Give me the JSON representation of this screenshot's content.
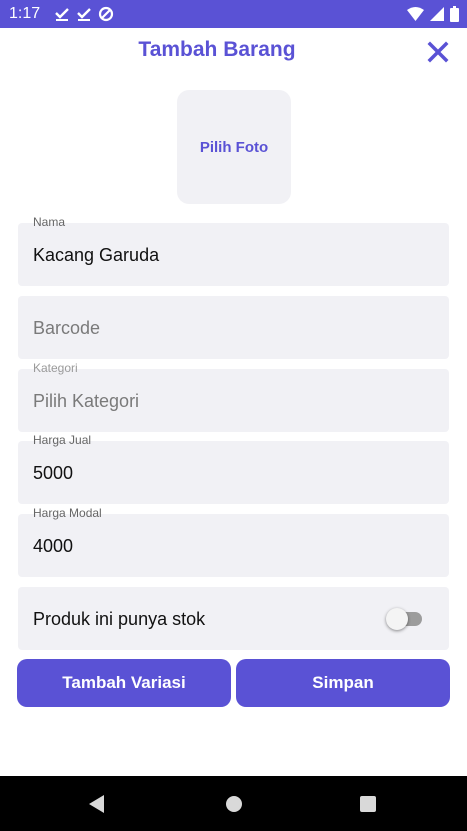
{
  "status_bar": {
    "time": "1:17",
    "left_icons": [
      "check-icon",
      "check-icon",
      "data-saver-icon"
    ],
    "right_icons": [
      "wifi-icon",
      "signal-icon",
      "battery-icon"
    ],
    "color": "#5a52d5"
  },
  "header": {
    "title": "Tambah Barang",
    "close_icon": "close-icon",
    "accent_color": "#5a52d5"
  },
  "photo": {
    "label": "Pilih Foto"
  },
  "fields": [
    {
      "label": "Nama",
      "value": "Kacang Garuda",
      "placeholder": ""
    },
    {
      "label": "",
      "value": "",
      "placeholder": "Barcode"
    },
    {
      "label": "Kategori",
      "value": "",
      "placeholder": "Pilih Kategori"
    },
    {
      "label": "Harga Jual",
      "value": "5000",
      "placeholder": ""
    },
    {
      "label": "Harga Modal",
      "value": "4000",
      "placeholder": ""
    }
  ],
  "stock_toggle": {
    "label": "Produk ini punya stok",
    "on": false
  },
  "buttons": {
    "add_variation": "Tambah Variasi",
    "save": "Simpan"
  },
  "nav_bar": {
    "icons": [
      "back-icon",
      "home-icon",
      "recents-icon"
    ]
  }
}
